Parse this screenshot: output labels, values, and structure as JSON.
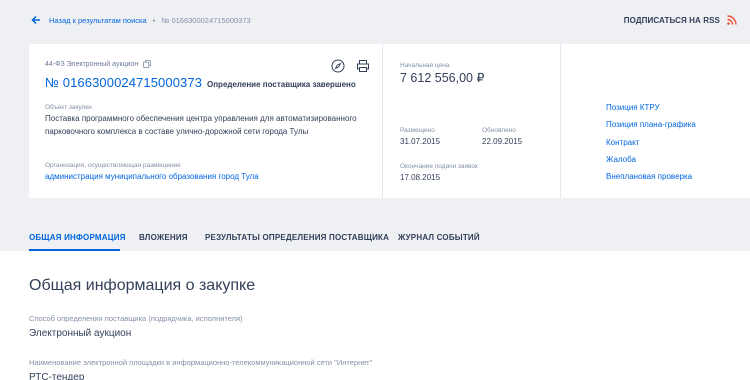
{
  "breadcrumb": {
    "back_label": "Назад к результатам поиска",
    "separator": "•",
    "current": "№ 0166300024715000373"
  },
  "rss": {
    "label": "ПОДПИСАТЬСЯ НА RSS"
  },
  "card": {
    "law": "44-ФЗ  Электронный аукцион",
    "number": "№ 0166300024715000373",
    "status": "Определение поставщика завершено",
    "object_label": "Объект закупки",
    "object_value": "Поставка программного обеспечения центра управления для автоматизированного парковочного комплекса в составе улично-дорожной сети города Тулы",
    "org_label": "Организация, осуществляющая размещение",
    "org_value": "администрация муниципального образования город Тула",
    "price_label": "Начальная цена",
    "price_value": "7 612 556,00 ₽",
    "posted_label": "Размещено",
    "posted_value": "31.07.2015",
    "updated_label": "Обновлено",
    "updated_value": "22.09.2015",
    "deadline_label": "Окончание подачи заявок",
    "deadline_value": "17.08.2015",
    "links": [
      "Позиция КТРУ",
      "Позиция плана-графика",
      "Контракт",
      "Жалоба",
      "Внеплановая проверка"
    ]
  },
  "tabs": [
    "ОБЩАЯ ИНФОРМАЦИЯ",
    "ВЛОЖЕНИЯ",
    "РЕЗУЛЬТАТЫ ОПРЕДЕЛЕНИЯ ПОСТАВЩИКА",
    "ЖУРНАЛ СОБЫТИЙ"
  ],
  "main": {
    "title": "Общая информация о закупке",
    "method_label": "Способ определения поставщика (подрядчика, исполнителя)",
    "method_value": "Электронный аукцион",
    "platform_label": "Наименование электронной площадки в информационно-телекоммуникационной сети \"Интернет\"",
    "platform_value": "РТС-тендер"
  },
  "colors": {
    "accent": "#0065dd",
    "text": "#334059",
    "muted": "#8490a8",
    "rss": "#e8553a"
  }
}
